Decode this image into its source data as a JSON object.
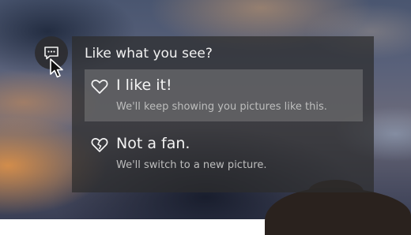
{
  "prompt": {
    "title": "Like what you see?"
  },
  "options": [
    {
      "label": "I like it!",
      "description": "We'll keep showing you pictures like this.",
      "icon": "heart-outline-icon",
      "selected": true
    },
    {
      "label": "Not a fan.",
      "description": "We'll switch to a new picture.",
      "icon": "broken-heart-icon",
      "selected": false
    }
  ],
  "feedback_button": {
    "icon": "chat-bubble-icon"
  },
  "colors": {
    "panel_bg": "#2d2d2d",
    "selected_bg": "#8c8c8c",
    "text_primary": "#f4f4f4",
    "text_secondary": "#bdbdbd"
  }
}
